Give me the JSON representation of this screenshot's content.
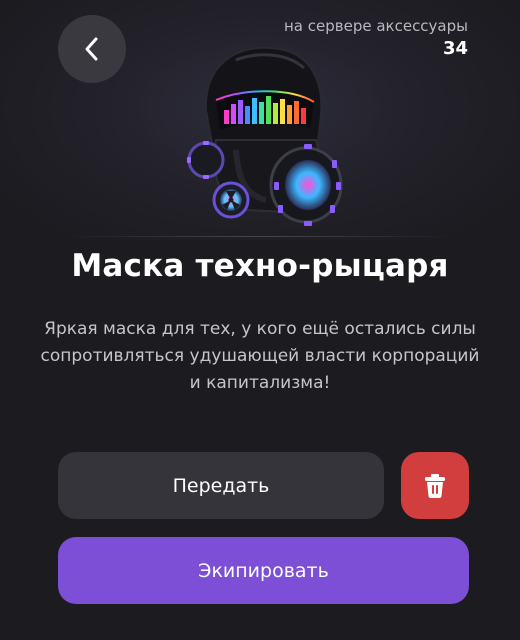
{
  "header": {
    "back_icon": "chevron-left-icon",
    "counter_label": "на сервере аксессуары",
    "counter_value": "34"
  },
  "item": {
    "image": "techno-knight-mask-image",
    "title": "Маска техно-рыцаря",
    "description": "Яркая маска для тех, у кого ещё остались силы сопротивляться удушающей власти корпораций и капитализма!"
  },
  "actions": {
    "transfer_label": "Передать",
    "delete_icon": "trash-icon",
    "equip_label": "Экипировать"
  },
  "colors": {
    "background": "#1c1b20",
    "transfer_button": "#35343b",
    "delete_button": "#d23d3d",
    "equip_button": "#7d4fd6"
  }
}
